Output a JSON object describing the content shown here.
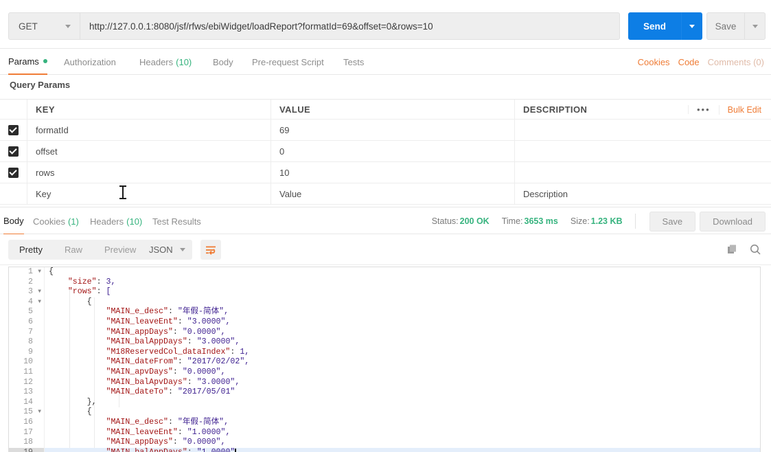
{
  "request": {
    "method": "GET",
    "url": "http://127.0.0.1:8080/jsf/rfws/ebiWidget/loadReport?formatId=69&offset=0&rows=10",
    "send_label": "Send",
    "save_label": "Save"
  },
  "request_tabs": [
    {
      "label": "Params",
      "active": true,
      "dot": true
    },
    {
      "label": "Authorization",
      "active": false
    },
    {
      "label": "Headers",
      "count": "(10)",
      "active": false
    },
    {
      "label": "Body",
      "active": false
    },
    {
      "label": "Pre-request Script",
      "active": false
    },
    {
      "label": "Tests",
      "active": false
    }
  ],
  "request_links": {
    "cookies": "Cookies",
    "code": "Code",
    "comments": "Comments (0)"
  },
  "query_params": {
    "title": "Query Params",
    "columns": {
      "key": "KEY",
      "value": "VALUE",
      "description": "DESCRIPTION"
    },
    "bulk_edit": "Bulk Edit",
    "more": "•••",
    "rows": [
      {
        "checked": true,
        "key": "formatId",
        "value": "69",
        "description": ""
      },
      {
        "checked": true,
        "key": "offset",
        "value": "0",
        "description": ""
      },
      {
        "checked": true,
        "key": "rows",
        "value": "10",
        "description": ""
      }
    ],
    "placeholders": {
      "key": "Key",
      "value": "Value",
      "description": "Description"
    }
  },
  "response_tabs": [
    {
      "label": "Body",
      "active": true
    },
    {
      "label": "Cookies",
      "count": "(1)",
      "active": false
    },
    {
      "label": "Headers",
      "count": "(10)",
      "active": false
    },
    {
      "label": "Test Results",
      "active": false
    }
  ],
  "response_status": {
    "status_label": "Status:",
    "status_value": "200 OK",
    "time_label": "Time:",
    "time_value": "3653 ms",
    "size_label": "Size:",
    "size_value": "1.23 KB",
    "save_label": "Save",
    "download_label": "Download"
  },
  "body_toolbar": {
    "views": [
      {
        "label": "Pretty",
        "active": true
      },
      {
        "label": "Raw",
        "active": false
      },
      {
        "label": "Preview",
        "active": false
      }
    ],
    "format": "JSON",
    "wrap_icon": "word-wrap-icon",
    "copy_icon": "copy-icon",
    "search_icon": "search-icon"
  },
  "code": {
    "active_line": 19,
    "lines": [
      {
        "n": 1,
        "fold": true,
        "text": "{"
      },
      {
        "n": 2,
        "fold": false,
        "text": "    \"size\": 3,"
      },
      {
        "n": 3,
        "fold": true,
        "text": "    \"rows\": ["
      },
      {
        "n": 4,
        "fold": true,
        "text": "        {"
      },
      {
        "n": 5,
        "fold": false,
        "text": "            \"MAIN_e_desc\": \"年假-简体\","
      },
      {
        "n": 6,
        "fold": false,
        "text": "            \"MAIN_leaveEnt\": \"3.0000\","
      },
      {
        "n": 7,
        "fold": false,
        "text": "            \"MAIN_appDays\": \"0.0000\","
      },
      {
        "n": 8,
        "fold": false,
        "text": "            \"MAIN_balAppDays\": \"3.0000\","
      },
      {
        "n": 9,
        "fold": false,
        "text": "            \"M18ReservedCol_dataIndex\": 1,"
      },
      {
        "n": 10,
        "fold": false,
        "text": "            \"MAIN_dateFrom\": \"2017/02/02\","
      },
      {
        "n": 11,
        "fold": false,
        "text": "            \"MAIN_apvDays\": \"0.0000\","
      },
      {
        "n": 12,
        "fold": false,
        "text": "            \"MAIN_balApvDays\": \"3.0000\","
      },
      {
        "n": 13,
        "fold": false,
        "text": "            \"MAIN_dateTo\": \"2017/05/01\""
      },
      {
        "n": 14,
        "fold": false,
        "text": "        },"
      },
      {
        "n": 15,
        "fold": true,
        "text": "        {"
      },
      {
        "n": 16,
        "fold": false,
        "text": "            \"MAIN_e_desc\": \"年假-简体\","
      },
      {
        "n": 17,
        "fold": false,
        "text": "            \"MAIN_leaveEnt\": \"1.0000\","
      },
      {
        "n": 18,
        "fold": false,
        "text": "            \"MAIN_appDays\": \"0.0000\","
      },
      {
        "n": 19,
        "fold": false,
        "text": "            \"MAIN_balAppDays\": \"1.0000\","
      }
    ]
  },
  "colors": {
    "accent_orange": "#ef7c36",
    "send_blue": "#0d7ee5",
    "status_green": "#36b37e",
    "code_purple": "#3c1e8f",
    "code_key_red": "#a31515"
  }
}
